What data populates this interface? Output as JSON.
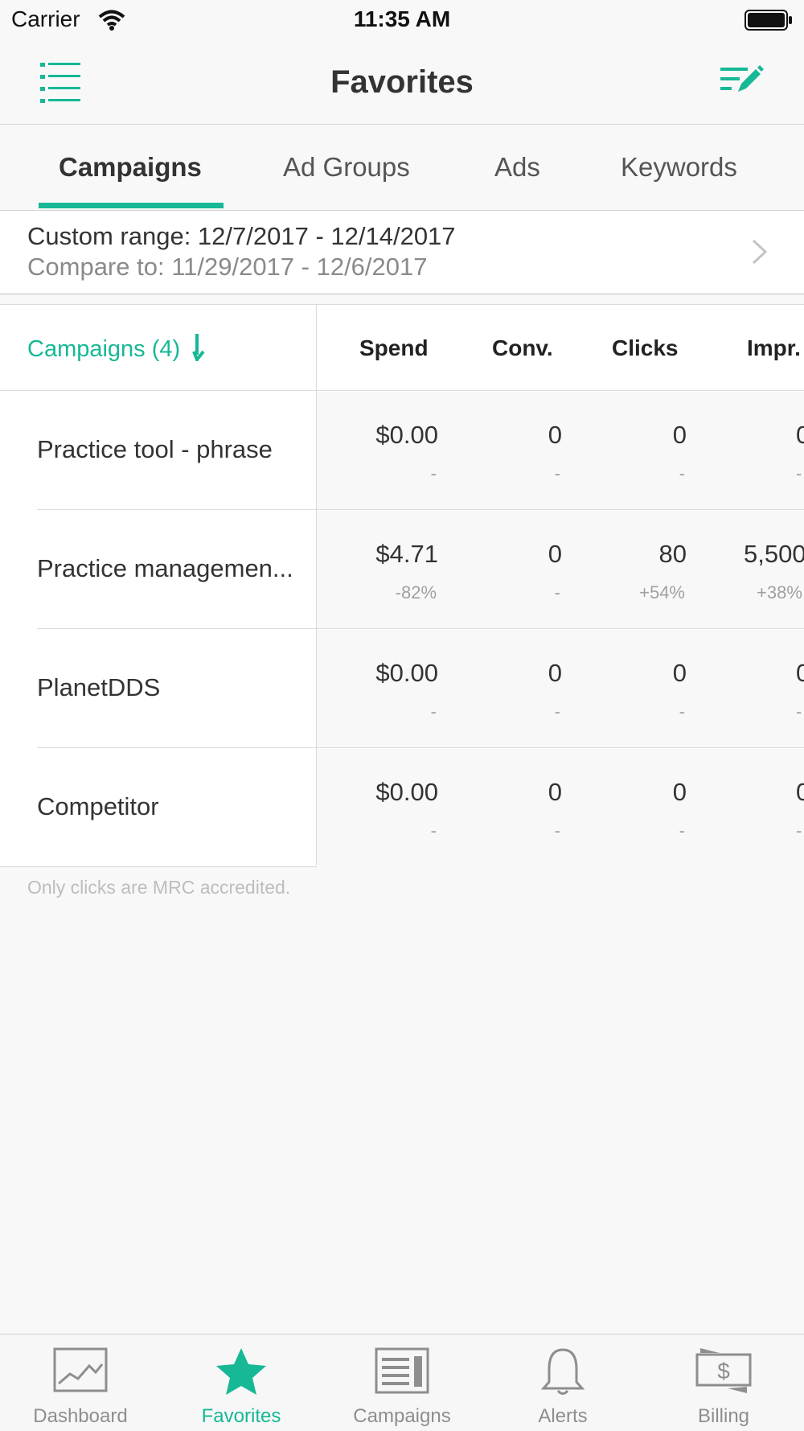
{
  "status_bar": {
    "carrier": "Carrier",
    "time": "11:35 AM"
  },
  "nav": {
    "title": "Favorites",
    "menu_icon": "list-icon",
    "edit_icon": "edit-list-icon"
  },
  "tabs": [
    {
      "label": "Campaigns",
      "selected": true
    },
    {
      "label": "Ad Groups",
      "selected": false
    },
    {
      "label": "Ads",
      "selected": false
    },
    {
      "label": "Keywords",
      "selected": false
    }
  ],
  "date_range": {
    "main": "Custom range: 12/7/2017 - 12/14/2017",
    "compare": "Compare to: 11/29/2017 -  12/6/2017"
  },
  "table": {
    "name_header": "Campaigns (4)",
    "columns": [
      "Spend",
      "Conv.",
      "Clicks",
      "Impr."
    ],
    "rows": [
      {
        "name": "Practice tool - phrase",
        "spend": "$0.00",
        "spend_chg": "-",
        "conv": "0",
        "conv_chg": "-",
        "clicks": "0",
        "clicks_chg": "-",
        "impr": "0",
        "impr_chg": "-"
      },
      {
        "name": "Practice managemen...",
        "spend": "$4.71",
        "spend_chg": "-82%",
        "conv": "0",
        "conv_chg": "-",
        "clicks": "80",
        "clicks_chg": "+54%",
        "impr": "5,500",
        "impr_chg": "+38%"
      },
      {
        "name": "PlanetDDS",
        "spend": "$0.00",
        "spend_chg": "-",
        "conv": "0",
        "conv_chg": "-",
        "clicks": "0",
        "clicks_chg": "-",
        "impr": "0",
        "impr_chg": "-"
      },
      {
        "name": "Competitor",
        "spend": "$0.00",
        "spend_chg": "-",
        "conv": "0",
        "conv_chg": "-",
        "clicks": "0",
        "clicks_chg": "-",
        "impr": "0",
        "impr_chg": "-"
      }
    ],
    "footnote": "Only clicks are MRC accredited."
  },
  "tab_bar": {
    "items": [
      {
        "label": "Dashboard",
        "icon": "chart-icon",
        "active": false
      },
      {
        "label": "Favorites",
        "icon": "star-icon",
        "active": true
      },
      {
        "label": "Campaigns",
        "icon": "campaigns-icon",
        "active": false
      },
      {
        "label": "Alerts",
        "icon": "bell-icon",
        "active": false
      },
      {
        "label": "Billing",
        "icon": "billing-icon",
        "active": false
      }
    ]
  },
  "colors": {
    "accent": "#16b896",
    "inactive": "#8e8e8e"
  }
}
